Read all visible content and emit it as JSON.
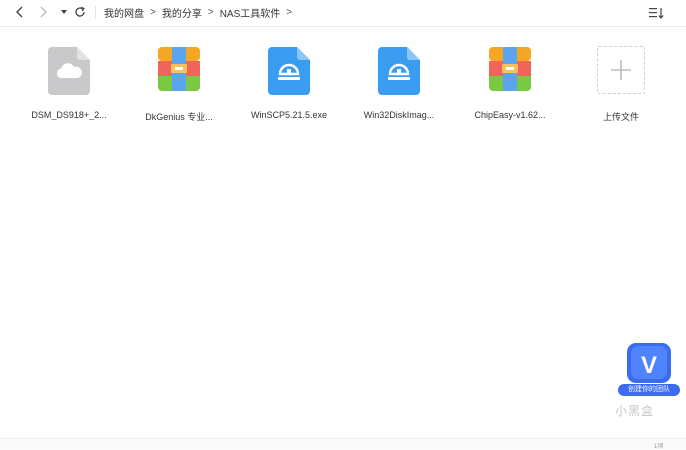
{
  "breadcrumb": {
    "items": [
      "我的网盘",
      "我的分享",
      "NAS工具软件"
    ],
    "separator": ">"
  },
  "files": [
    {
      "name": "DSM_DS918+_2...",
      "icon": "cloud-file-icon"
    },
    {
      "name": "DkGenius 专业...",
      "icon": "archive-icon"
    },
    {
      "name": "WinSCP5.21.5.exe",
      "icon": "exe-file-icon"
    },
    {
      "name": "Win32DiskImag...",
      "icon": "exe-file-icon"
    },
    {
      "name": "ChipEasy-v1.62...",
      "icon": "archive-icon"
    }
  ],
  "upload": {
    "label": "上传文件"
  },
  "badge": {
    "letter": "V",
    "caption": "创建你的团队"
  },
  "watermark": "小黑盒",
  "footer": {
    "text": "1项"
  },
  "colors": {
    "archive_orange": "#f5a623",
    "archive_red": "#f0645a",
    "archive_green": "#7ac943",
    "exe_blue": "#3a9df2",
    "cloud_gray": "#c9c9cc",
    "badge_blue": "#3b6cf0"
  }
}
